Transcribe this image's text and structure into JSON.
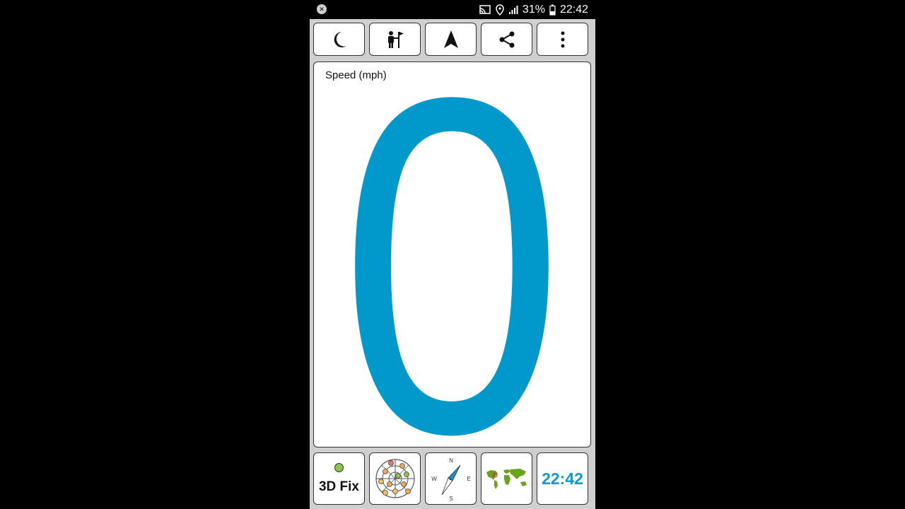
{
  "status_bar": {
    "battery_percent": "31%",
    "time": "22:42"
  },
  "toolbar": {
    "buttons": [
      {
        "icon": "moon-icon"
      },
      {
        "icon": "person-flag-icon"
      },
      {
        "icon": "navigation-arrow-icon"
      },
      {
        "icon": "share-icon"
      },
      {
        "icon": "more-vertical-icon"
      }
    ]
  },
  "speed_panel": {
    "title": "Speed (mph)",
    "value": "0",
    "value_color": "#0199cc"
  },
  "bottom_bar": {
    "gps_fix_label": "3D Fix",
    "gps_fix_color": "#8bc34a",
    "compass": {
      "n": "N",
      "e": "E",
      "s": "S",
      "w": "W"
    },
    "clock": "22:42",
    "clock_color": "#0a9bd0"
  }
}
